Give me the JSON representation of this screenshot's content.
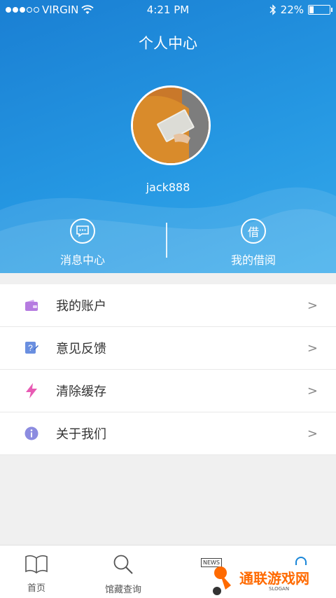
{
  "status_bar": {
    "carrier": "VIRGIN",
    "time": "4:21 PM",
    "battery_text": "22%",
    "battery_level": 0.22,
    "signal_bars_filled": 3,
    "signal_bars_total": 5
  },
  "header": {
    "title": "个人中心",
    "username": "jack888",
    "gradient_colors": [
      "#1a7fd3",
      "#35a9ea"
    ]
  },
  "quick_actions": [
    {
      "label": "消息中心",
      "icon": "message-bubble-icon"
    },
    {
      "label": "我的借阅",
      "icon_glyph": "借",
      "icon": "borrow-icon"
    }
  ],
  "menu": {
    "items": [
      {
        "label": "我的账户",
        "icon": "wallet-icon",
        "color": "#b57be0"
      },
      {
        "label": "意见反馈",
        "icon": "feedback-icon",
        "color": "#6a8fe0"
      },
      {
        "label": "清除缓存",
        "icon": "lightning-icon",
        "color": "#e85bb4"
      },
      {
        "label": "关于我们",
        "icon": "info-icon",
        "color": "#8c8ce0"
      }
    ],
    "chevron": ">"
  },
  "tabbar": {
    "tabs": [
      {
        "label": "首页",
        "icon": "book-icon"
      },
      {
        "label": "馆藏查询",
        "icon": "search-icon"
      },
      {
        "label": "",
        "icon": "news-icon",
        "icon_text": "NEWS"
      },
      {
        "label": "",
        "icon": "user-icon"
      }
    ]
  },
  "watermark": {
    "text": "通联游戏网",
    "slogan": "SLOGAN",
    "color": "#ff6a00"
  }
}
